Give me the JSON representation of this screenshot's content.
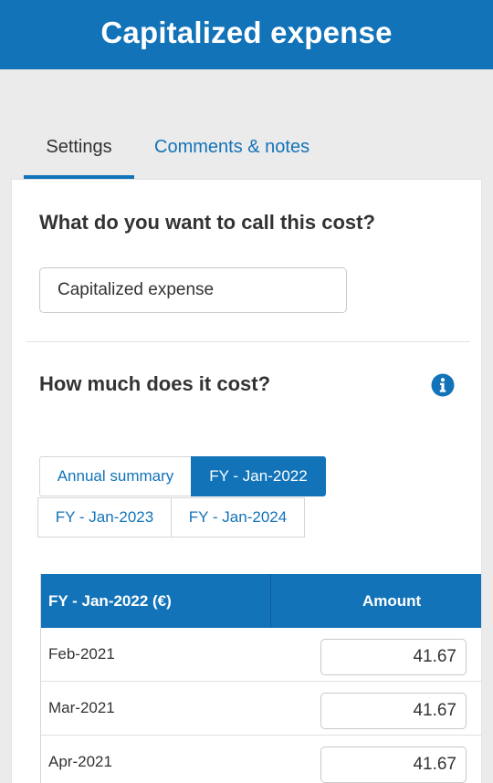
{
  "header": {
    "title": "Capitalized expense"
  },
  "tabs": [
    {
      "label": "Settings",
      "active": true
    },
    {
      "label": "Comments & notes",
      "active": false
    }
  ],
  "name_section": {
    "question": "What do you want to call this cost?",
    "value": "Capitalized expense"
  },
  "cost_section": {
    "question": "How much does it cost?",
    "info_icon": "info-circle-icon"
  },
  "period_buttons": [
    {
      "label": "Annual summary",
      "active": false
    },
    {
      "label": "FY - Jan-2022",
      "active": true
    },
    {
      "label": "FY - Jan-2023",
      "active": false
    },
    {
      "label": "FY - Jan-2024",
      "active": false
    }
  ],
  "table": {
    "col_period": "FY - Jan-2022 (€)",
    "col_amount": "Amount",
    "rows": [
      {
        "month": "Feb-2021",
        "amount": "41.67"
      },
      {
        "month": "Mar-2021",
        "amount": "41.67"
      },
      {
        "month": "Apr-2021",
        "amount": "41.67"
      }
    ]
  },
  "colors": {
    "accent": "#1273b9",
    "background": "#ebebeb"
  }
}
